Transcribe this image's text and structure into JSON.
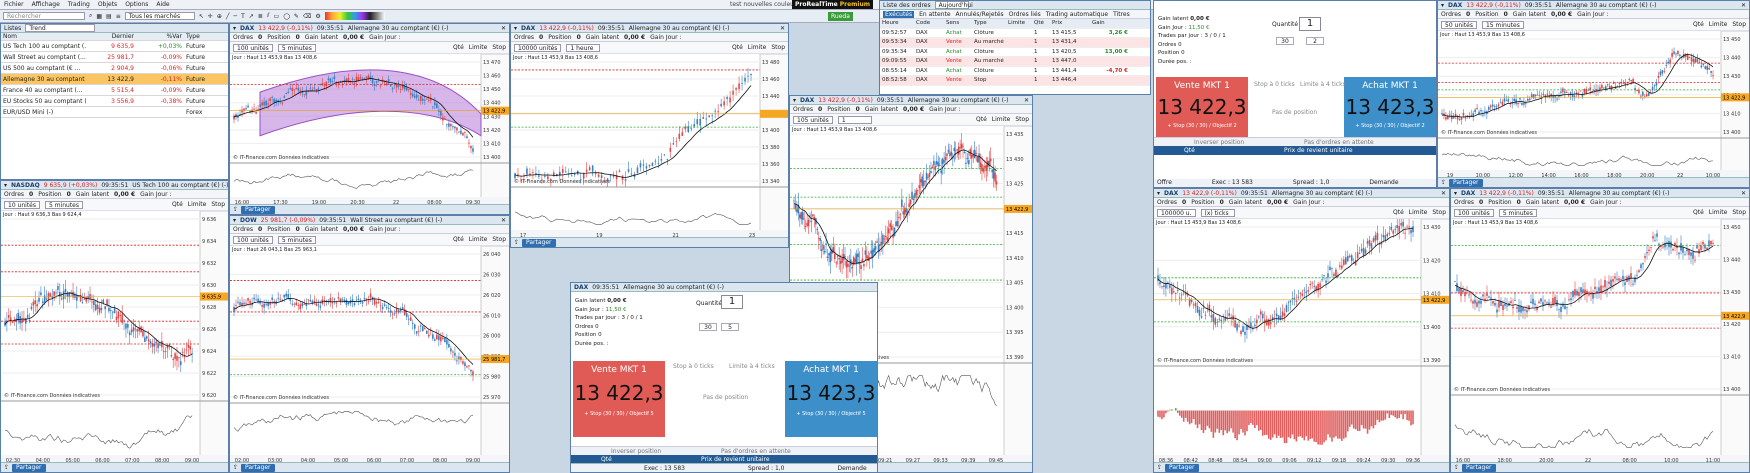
{
  "menu": [
    "Fichier",
    "Affichage",
    "Trading",
    "Objets",
    "Options",
    "Aide"
  ],
  "window_title": "test nouvelles couleurs 2",
  "brand": {
    "pro": "ProRealTime",
    "edition": "Premium"
  },
  "toolbar": {
    "search_placeholder": "Rechercher",
    "market_select": "Tous les marchés",
    "route": "Rueda"
  },
  "watchlist": {
    "title": "Listes",
    "list_name": "Trend",
    "headers": [
      "Nom",
      "Dernier",
      "%Var",
      "Type"
    ],
    "rows": [
      {
        "name": "US Tech 100 au comptant (...",
        "last": "9 635,9",
        "var": "+0,03%",
        "type": "Future"
      },
      {
        "name": "Wall Street au comptant (...",
        "last": "25 981,7",
        "var": "-0,09%",
        "type": "Future"
      },
      {
        "name": "US 500 au comptant (€ ...",
        "last": "2 904,9",
        "var": "-0,06%",
        "type": "Future"
      },
      {
        "name": "Allemagne 30 au comptant (...",
        "last": "13 422,9",
        "var": "-0,11%",
        "type": "Future"
      },
      {
        "name": "France 40 au comptant (...",
        "last": "5 515,4",
        "var": "-0,09%",
        "type": "Future"
      },
      {
        "name": "EU Stocks 50 au comptant (...",
        "last": "3 556,9",
        "var": "-0,38%",
        "type": "Future"
      },
      {
        "name": "EUR/USD Mini (-)",
        "last": "",
        "var": "",
        "type": "Forex"
      }
    ]
  },
  "common": {
    "ordres": "Ordres",
    "position": "Position",
    "gain_latent": "Gain latent",
    "gain_jour": "Gain Jour :",
    "zero_eur": "0,00 €",
    "zero": "0",
    "qte": "Qté",
    "limite": "Limite",
    "stop": "Stop",
    "share": "Partager",
    "source": "© IT-Finance.com  Données indicatives",
    "fois": "(x) ticks"
  },
  "charts": {
    "dax_30s": {
      "head": "DAX",
      "head_price": "13 422,9 (-0,11%)",
      "time": "09:35:51",
      "name": "Allemagne 30 au comptant (€) (-)",
      "units": "100 unités",
      "tf": "5 minutes",
      "info": "Jour : Haut 13 453,9  Bas 13 408,6",
      "axis": [
        "13 470",
        "13 460",
        "13 450",
        "13 440",
        "13 430",
        "13 420",
        "13 410",
        "13 400"
      ],
      "times": [
        "16:00",
        "17:30",
        "19:00",
        "20:30",
        "22",
        "08:00",
        "09:30"
      ],
      "tags": {
        "stop": "2 ordres 13 431,1",
        "price": "13 422,9",
        "target": "@13 446,1 13 425,9 27,9"
      }
    },
    "dax_h": {
      "head": "DAX",
      "head_price": "13 422,9 (-0,11%)",
      "time": "09:35:51",
      "name": "Allemagne 30 au comptant (€) (-)",
      "units": "10000 unités",
      "tf": "1 heure",
      "info": "Jour : Haut 13 453,9  Bas 13 408,6",
      "axis": [
        "13 480",
        "13 460",
        "13 440",
        "13 420",
        "13 400",
        "13 380",
        "13 360",
        "13 340"
      ],
      "times": [
        "17",
        "19",
        "21",
        "23"
      ],
      "tags": {
        "haut": "Haut 13 453,9",
        "ordres": "3 ordres",
        "ordres2": "2 ordres 7,9",
        "osc": "61,788"
      }
    },
    "orders": {
      "tabs": [
        "Exécutés",
        "En attente",
        "Annulés/Rejetés",
        "Ordres liés",
        "Trading automatique",
        "Titres"
      ],
      "filter": "Aujourd'hui",
      "headers": [
        "Heure",
        "Code",
        "Sens",
        "Type",
        "Limite",
        "Qté",
        "Prix",
        "Gain"
      ],
      "rows": [
        {
          "t": "09:52:57",
          "c": "DAX",
          "s": "Achat",
          "ty": "Clôture",
          "l": "1",
          "p": "13 415,5",
          "g": "3,26 €",
          "gc": "#2a8a2a"
        },
        {
          "t": "09:53:34",
          "c": "DAX",
          "s": "Vente",
          "ty": "Au marché",
          "l": "1",
          "p": "13 431,4",
          "g": "",
          "gc": "#222"
        },
        {
          "t": "09:35:34",
          "c": "DAX",
          "s": "Achat",
          "ty": "Clôture",
          "l": "1",
          "p": "13 420,5",
          "g": "13,00 €",
          "gc": "#2a8a2a"
        },
        {
          "t": "09:09:55",
          "c": "DAX",
          "s": "Vente",
          "ty": "Au marché",
          "l": "1",
          "p": "13 447,0",
          "g": "",
          "gc": "#222"
        },
        {
          "t": "08:55:14",
          "c": "DAX",
          "s": "Achat",
          "ty": "Clôture",
          "l": "1",
          "p": "13 441,4",
          "g": "-4,70 €",
          "gc": "#d22"
        },
        {
          "t": "08:52:58",
          "c": "DAX",
          "s": "Vente",
          "ty": "Stop",
          "l": "1",
          "p": "13 446,4",
          "g": "",
          "gc": "#222"
        }
      ]
    },
    "dax_mid": {
      "head": "DAX",
      "head_price": "13 422,9 (-0,11%)",
      "time": "09:35:51",
      "name": "Allemagne 30 au comptant (€) (-)",
      "units": "105 unités",
      "tf": "1",
      "info": "Jour : Haut 13 453,9  Bas 13 408,6",
      "axis": [
        "13 435",
        "13 430",
        "13 425",
        "13 420",
        "13 415",
        "13 410",
        "13 405",
        "13 400",
        "13 395",
        "13 390"
      ],
      "times": [
        "09:06",
        "09:09",
        "09:15",
        "09:21",
        "09:27",
        "09:33",
        "09:39",
        "09:45"
      ],
      "tags": {
        "price": "13 422,9",
        "base": "13 405,04",
        "osc": "61,063"
      }
    },
    "nasdaq": {
      "head": "NASDAQ",
      "head_price": "9 635,9 (+0,03%)",
      "time": "09:35:51",
      "name": "US Tech 100 au comptant (€) (-)",
      "units": "10 unités",
      "tf": "5 minutes",
      "info": "Jour : Haut 9 636,3  Bas 9 624,4",
      "axis": [
        "9 636",
        "9 634",
        "9 632",
        "9 630",
        "9 628",
        "9 626",
        "9 624",
        "9 622",
        "9 620"
      ],
      "times": [
        "02:30",
        "04:00",
        "05:00",
        "06:00",
        "07:00",
        "08:00",
        "09:00"
      ],
      "tags": {
        "price": "9 635,9"
      }
    },
    "dow": {
      "head": "DOW",
      "head_price": "25 981,7 (-0,09%)",
      "time": "09:35:51",
      "name": "Wall Street au comptant (€) (-)",
      "units": "100 unités",
      "tf": "5 minutes",
      "info": "Jour : Haut 26 043,1  Bas 25 963,1",
      "axis": [
        "26 040",
        "26 030",
        "26 020",
        "26 010",
        "26 000",
        "25 990",
        "25 980",
        "25 970"
      ],
      "times": [
        "02:00",
        "03:00",
        "04:00",
        "05:00",
        "06:00",
        "07:00",
        "08:00",
        "09:00"
      ],
      "tags": {
        "price": "25 981,7"
      }
    },
    "dax_right_top": {
      "head": "DAX",
      "head_price": "13 422,9 (-0,11%)",
      "time": "09:35:51",
      "name": "Allemagne 30 au comptant (€) (-)",
      "units": "50 unités",
      "tf": "15 minutes",
      "info": "Jour : Haut 13 453,9  Bas 13 408,6",
      "axis": [
        "13 450",
        "13 440",
        "13 430",
        "13 420",
        "13 410",
        "13 400"
      ],
      "times": [
        "19",
        "10:00",
        "12:00",
        "14:00",
        "16:00",
        "18:00",
        "20:00",
        "22",
        "10:00"
      ],
      "tags": {
        "price": "13 422,9",
        "osc": "-26,540"
      }
    },
    "dax_right_mid": {
      "head": "DAX",
      "head_price": "13 422,9 (-0,11%)",
      "time": "09:35:51",
      "name": "Allemagne 30 au comptant (€) (-)",
      "units": "100000 u.",
      "tf": "(x) ticks",
      "info": "Jour : Haut 13 453,9  Bas 13 408,6",
      "axis": [
        "13 430",
        "13 420",
        "13 410",
        "13 400",
        "13 390"
      ],
      "times": [
        "08:36",
        "08:42",
        "08:48",
        "08:54",
        "09:00",
        "09:06",
        "09:12",
        "09:18",
        "09:24",
        "09:30",
        "09:36"
      ],
      "tags": {
        "price": "13 422,9",
        "osc": "-59,226"
      }
    },
    "dax_right_far": {
      "head": "DAX",
      "head_price": "13 422,9 (-0,11%)",
      "time": "09:35:51",
      "name": "Allemagne 30 au comptant (€) (-)",
      "units": "100 unités",
      "tf": "5 minutes",
      "info": "Jour : Haut 13 453,9  Bas 13 408,6",
      "axis": [
        "13 450",
        "13 440",
        "13 430",
        "13 420",
        "13 410",
        "13 400"
      ],
      "times": [
        "16:00",
        "18:00",
        "20:00",
        "22",
        "08:00",
        "10:00",
        "11:00"
      ],
      "tags": {
        "price": "13 422,9",
        "osc": "4,1441"
      }
    }
  },
  "tickets": {
    "mid": {
      "head": "DAX",
      "time": "09:35:51",
      "name": "Allemagne 30 au comptant (€) (-)",
      "gain_latent": "0,00 €",
      "gain_jour": "11,50 €",
      "trades": "Trades par jour :",
      "trades_val": "3 / 0 / 1",
      "qty": "1",
      "stop_val": "30",
      "obj_val": "5",
      "sell_label": "Vente MKT 1",
      "buy_label": "Achat MKT 1",
      "sell_price": "13 422,3",
      "buy_price": "13 423,3",
      "sell_sub": "+ Stop (30 / 30) / Objectif 5",
      "buy_sub": "+ Stop (30 / 30) / Objectif 5",
      "stop_x": "Stop à 0 ticks",
      "limit_x": "Limite à 4 ticks",
      "no_pos": "Pas de position",
      "invert": "Inverser position",
      "no_order": "Pas d'ordres en attente",
      "qte": "Qté",
      "prix": "Prix de revient unitaire",
      "exec": "Exec : 13 583",
      "spread": "Spread : 1,0",
      "demande": "Demande"
    },
    "right": {
      "gain_latent": "0,00 €",
      "gain_jour": "11,50 €",
      "trades_val": "3 / 0 / 1",
      "qty": "1",
      "stop_val": "30",
      "obj_val": "2",
      "sell_label": "Vente MKT 1",
      "buy_label": "Achat MKT 1",
      "sell_price": "13 422,3",
      "buy_price": "13 423,3",
      "sell_sub": "+ Stop (30 / 30) / Objectif 2",
      "buy_sub": "+ Stop (30 / 30) / Objectif 2",
      "stop_x": "Stop à 0 ticks",
      "limit_x": "Limite à 4 ticks",
      "no_pos": "Pas de position",
      "invert": "Inverser position",
      "no_order": "Pas d'ordres en attente",
      "exec": "Exec : 13 583",
      "spread": "Spread : 1,0",
      "demande": "Demande",
      "offre": "Offre",
      "duree": "Durée pos. :"
    }
  }
}
